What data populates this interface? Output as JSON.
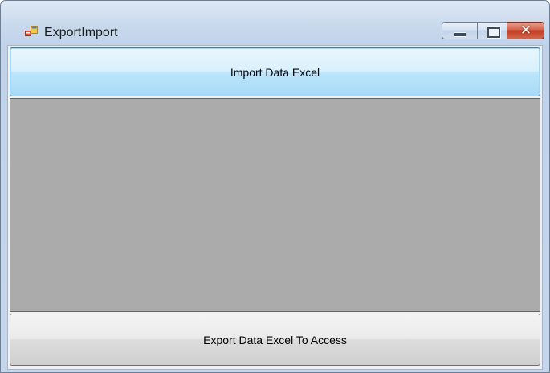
{
  "window": {
    "title": "ExportImport",
    "icon": "windows-forms-app-icon"
  },
  "caption_buttons": {
    "minimize_icon": "minimize-icon",
    "maximize_icon": "maximize-icon",
    "close_icon": "close-icon",
    "close_glyph": "✕"
  },
  "buttons": {
    "import_label": "Import Data Excel",
    "export_label": "Export Data Excel To Access"
  },
  "grid": {
    "background_color": "#ababab"
  },
  "colors": {
    "close_button": "#c23c21",
    "focused_button_border": "#3c7fb1"
  }
}
